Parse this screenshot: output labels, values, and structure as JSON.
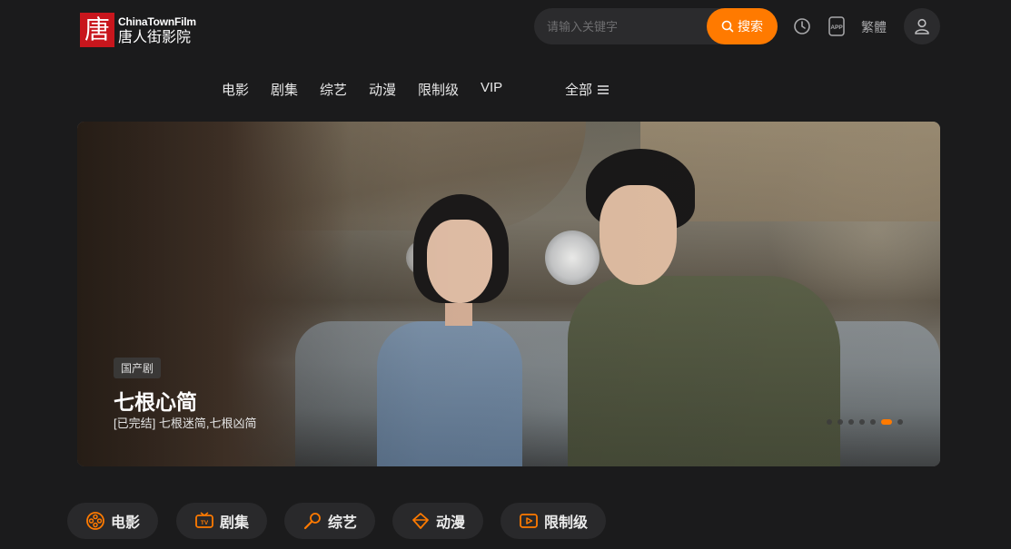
{
  "header": {
    "logo_char": "唐",
    "logo_en": "ChinaTownFilm",
    "logo_cn": "唐人街影院",
    "search_placeholder": "请输入关键字",
    "search_button": "搜索",
    "history_icon": "clock-icon",
    "app_icon": "app-icon",
    "lang_label": "繁體",
    "user_icon": "user-icon"
  },
  "nav": {
    "items": [
      "电影",
      "剧集",
      "综艺",
      "动漫",
      "限制级",
      "VIP"
    ],
    "all_label": "全部"
  },
  "banner": {
    "tag": "国产剧",
    "title": "七根心简",
    "subtitle": "[已完结] 七根迷简,七根凶简",
    "slide_count": 7,
    "active_slide": 5
  },
  "categories": [
    {
      "label": "电影",
      "icon": "film-reel-icon"
    },
    {
      "label": "剧集",
      "icon": "tv-icon"
    },
    {
      "label": "综艺",
      "icon": "microphone-icon"
    },
    {
      "label": "动漫",
      "icon": "anime-icon"
    },
    {
      "label": "限制级",
      "icon": "play-icon"
    }
  ],
  "colors": {
    "accent": "#ff7a00",
    "background": "#1b1b1c",
    "pill": "#29292b"
  }
}
